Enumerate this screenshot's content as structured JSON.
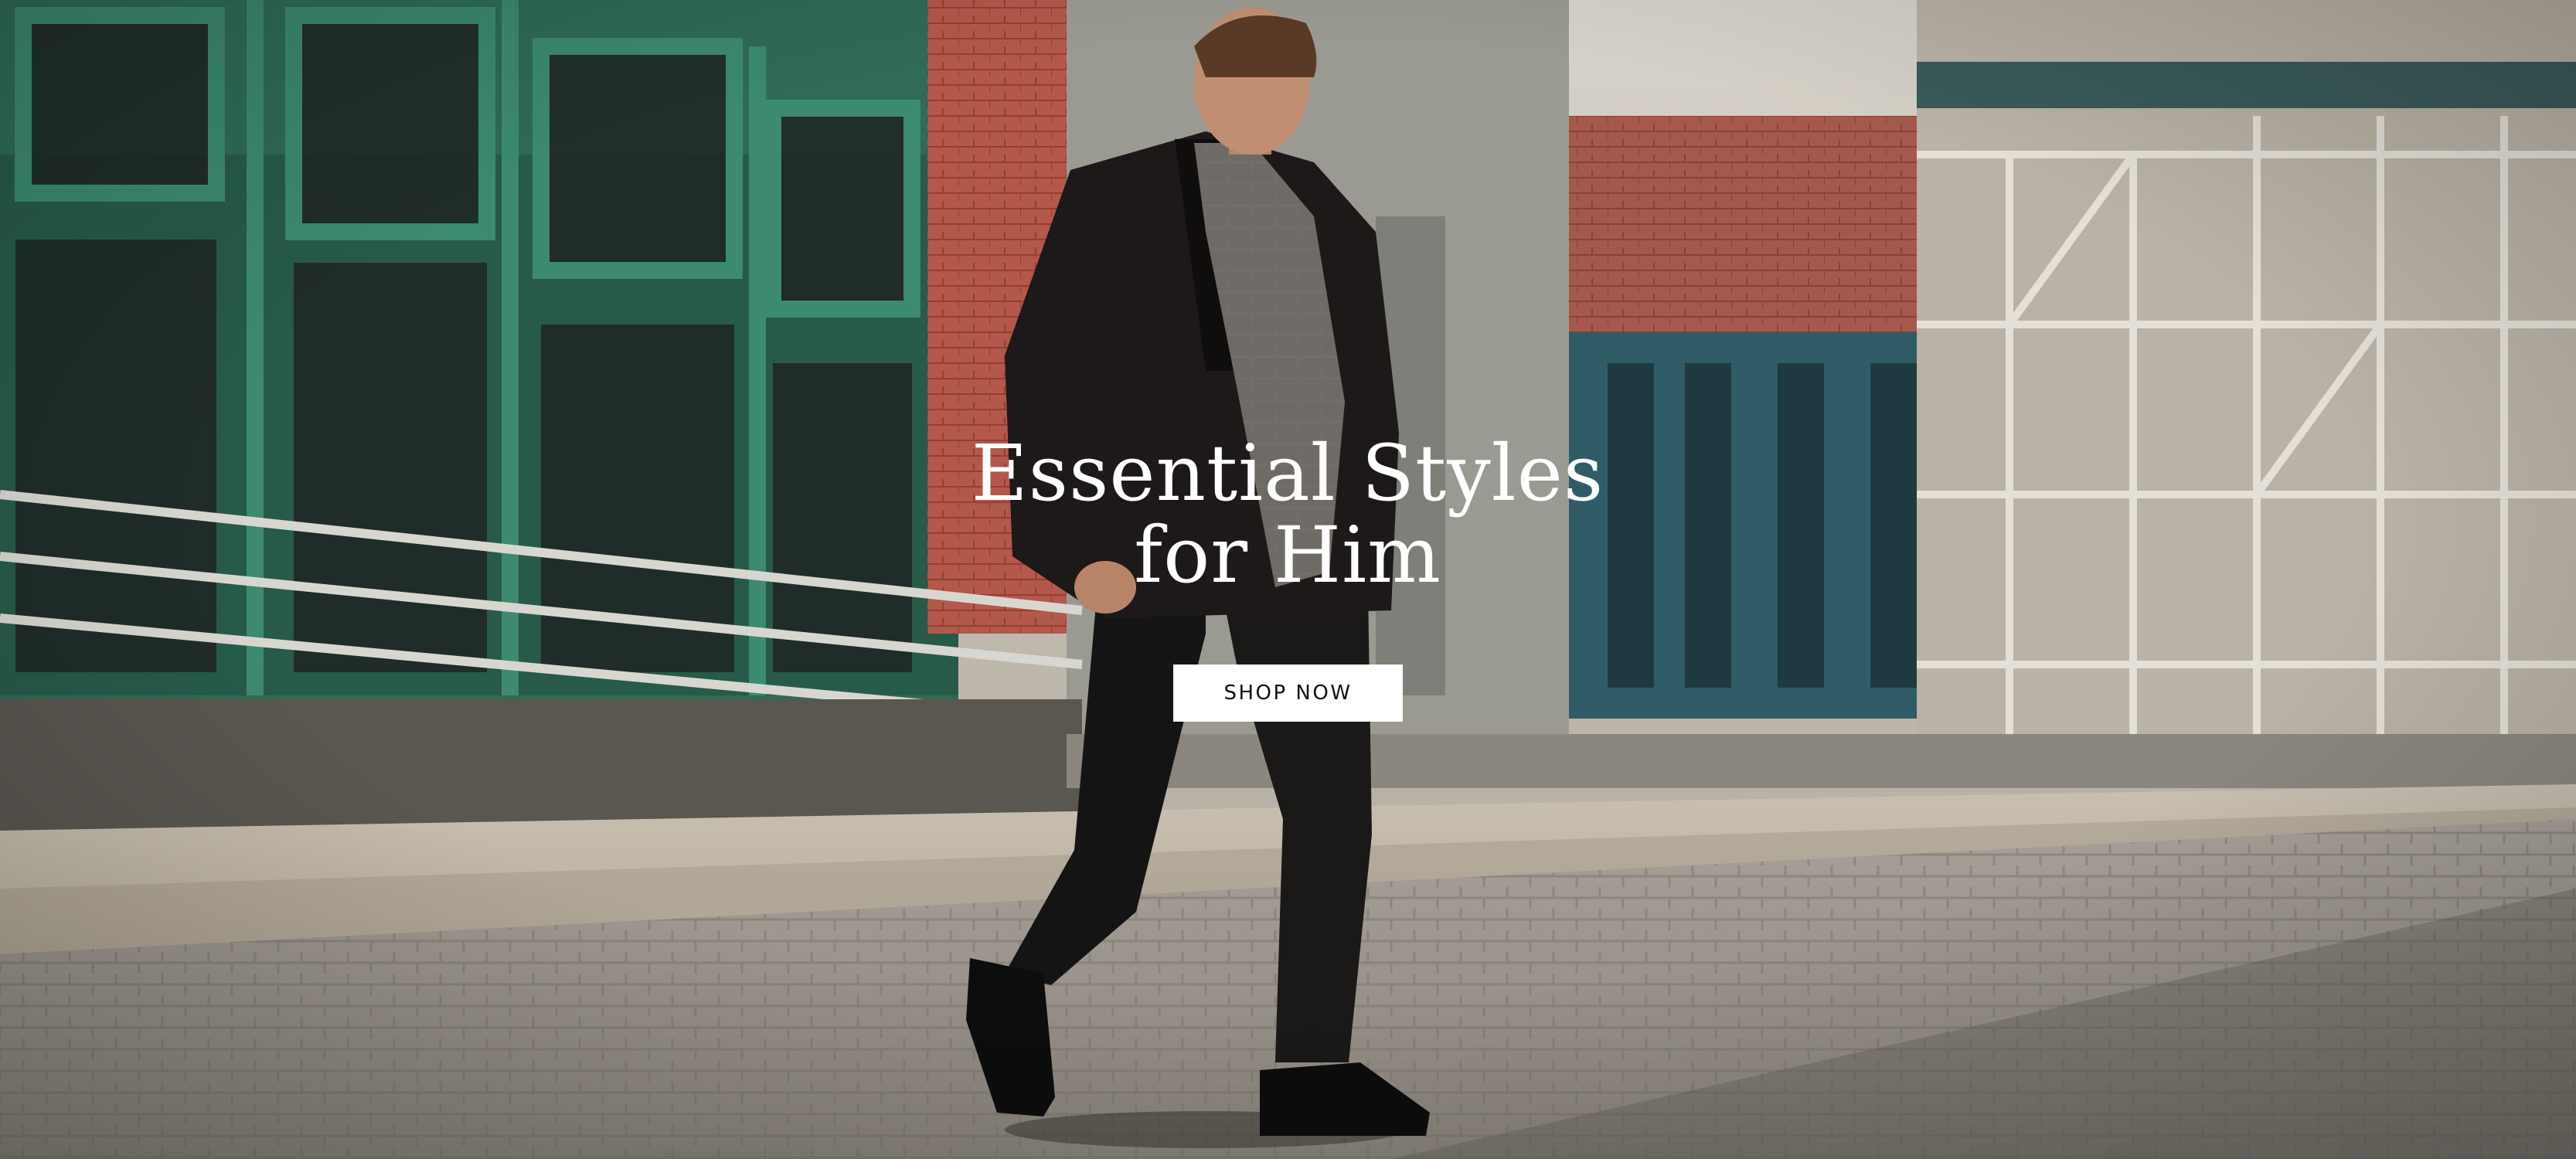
{
  "hero": {
    "title_line1": "Essential Styles",
    "title_line2": "for Him",
    "cta_label": "SHOP NOW",
    "image_alt": "Man in black leather jacket, scarf and trousers walking on a cobblestone city street",
    "colors": {
      "text": "#ffffff",
      "button_bg": "#ffffff",
      "button_text": "#111111"
    }
  }
}
